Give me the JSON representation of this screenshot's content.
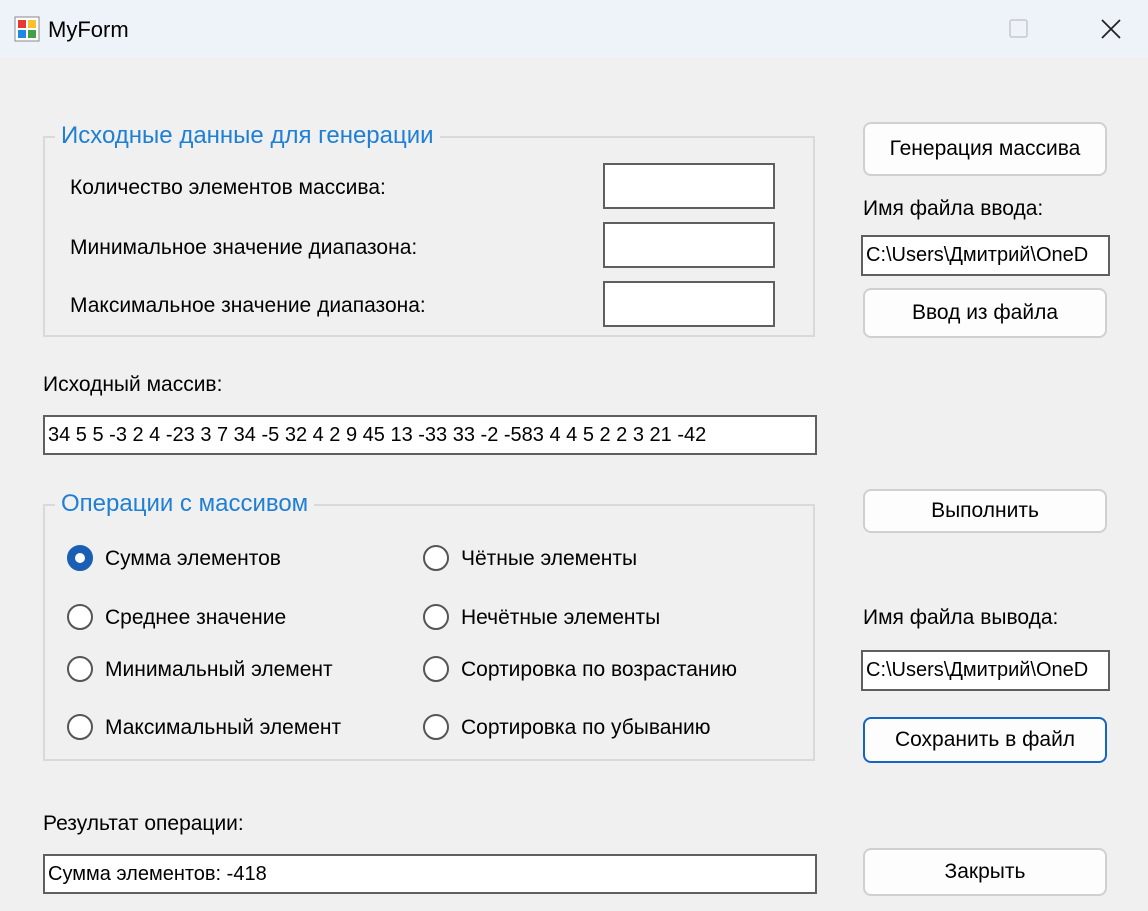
{
  "window": {
    "title": "MyForm"
  },
  "generation": {
    "title": "Исходные данные для генерации",
    "count_label": "Количество элементов массива:",
    "min_label": "Минимальное значение диапазона:",
    "max_label": "Максимальное значение диапазона:",
    "count_value": "",
    "min_value": "",
    "max_value": ""
  },
  "buttons": {
    "generate": "Генерация массива",
    "load": "Ввод из файла",
    "execute": "Выполнить",
    "save": "Сохранить в файл",
    "close": "Закрыть"
  },
  "input_file": {
    "label": "Имя файла ввода:",
    "value": "C:\\Users\\Дмитрий\\OneD"
  },
  "source_array": {
    "label": "Исходный массив:",
    "value": "34 5 5 -3 2 4 -23 3 7 34 -5 32 4 2 9 45 13 -33 33 -2 -583 4 4 5 2 2 3 21 -42"
  },
  "operations": {
    "title": "Операции с массивом",
    "options": [
      {
        "label": "Сумма элементов",
        "checked": true
      },
      {
        "label": "Среднее значение",
        "checked": false
      },
      {
        "label": "Минимальный элемент",
        "checked": false
      },
      {
        "label": "Максимальный элемент",
        "checked": false
      },
      {
        "label": "Чётные элементы",
        "checked": false
      },
      {
        "label": "Нечётные элементы",
        "checked": false
      },
      {
        "label": "Сортировка по возрастанию",
        "checked": false
      },
      {
        "label": "Сортировка по убыванию",
        "checked": false
      }
    ]
  },
  "output_file": {
    "label": "Имя файла вывода:",
    "value": "C:\\Users\\Дмитрий\\OneD"
  },
  "result": {
    "label": "Результат операции:",
    "value": "Сумма элементов: -418"
  },
  "colors": {
    "group_title": "#1e7fd4",
    "radio_checked": "#1a5fb4",
    "focus_border": "#1565c0"
  }
}
